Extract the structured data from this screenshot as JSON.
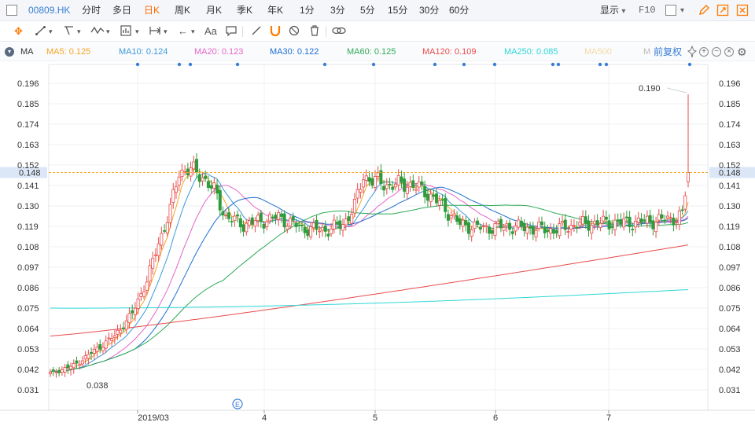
{
  "header": {
    "code": "00809.HK",
    "periods": [
      "分时",
      "多日",
      "日K",
      "周K",
      "月K",
      "季K",
      "年K",
      "1分",
      "3分",
      "5分",
      "15分",
      "30分",
      "60分"
    ],
    "active_period": "日K",
    "display_label": "显示",
    "f10_label": "F10"
  },
  "toolbar": {
    "text_tool": "Aa"
  },
  "ma": {
    "label": "MA",
    "items": [
      {
        "text": "MA5: 0.125",
        "color": "#f5a623"
      },
      {
        "text": "MA10: 0.124",
        "color": "#3a9ad9"
      },
      {
        "text": "MA20: 0.123",
        "color": "#e565c8"
      },
      {
        "text": "MA30: 0.122",
        "color": "#1d6fd1"
      },
      {
        "text": "MA60: 0.125",
        "color": "#2eaa55"
      },
      {
        "text": "MA120: 0.109",
        "color": "#e84b4b"
      },
      {
        "text": "MA250: 0.085",
        "color": "#2ed6d6"
      },
      {
        "text": "MA500",
        "color": "#f3d9a6"
      },
      {
        "text": "M",
        "color": "#bbbbbb"
      }
    ],
    "adjust_label": "前复权"
  },
  "chart_data": {
    "type": "candlestick",
    "y_ticks": [
      "0.196",
      "0.185",
      "0.174",
      "0.163",
      "0.152",
      "0.141",
      "0.130",
      "0.119",
      "0.108",
      "0.097",
      "0.086",
      "0.075",
      "0.064",
      "0.053",
      "0.042",
      "0.031"
    ],
    "ylim": [
      0.026,
      0.2
    ],
    "current_price": "0.148",
    "high_label": "0.190",
    "low_label": "0.038",
    "x_labels": [
      "2019/03",
      "4",
      "5",
      "6",
      "7"
    ],
    "event_marker": "E",
    "colors": {
      "up": "#e84b4b",
      "down": "#2e9c3c",
      "grid": "#eef0f3",
      "price_line": "#f5a623"
    }
  }
}
